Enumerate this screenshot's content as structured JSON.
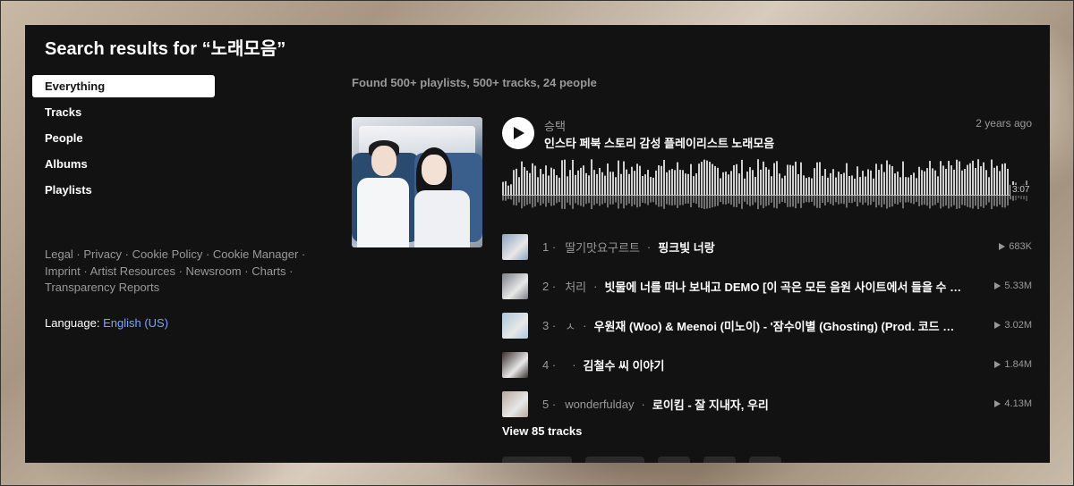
{
  "page": {
    "title": "Search results for “노래모음”"
  },
  "nav": {
    "items": [
      {
        "label": "Everything",
        "active": true
      },
      {
        "label": "Tracks",
        "active": false
      },
      {
        "label": "People",
        "active": false
      },
      {
        "label": "Albums",
        "active": false
      },
      {
        "label": "Playlists",
        "active": false
      }
    ]
  },
  "footer": {
    "links": [
      "Legal",
      "Privacy",
      "Cookie Policy",
      "Cookie Manager",
      "Imprint",
      "Artist Resources",
      "Newsroom",
      "Charts",
      "Transparency Reports"
    ],
    "separator": " · ",
    "language_label": "Language:",
    "language_value": "English (US)"
  },
  "results": {
    "summary": "Found 500+ playlists, 500+ tracks, 24 people"
  },
  "playlist": {
    "owner": "승택",
    "title": "인스타 페북 스토리 감성 플레이리스트 노래모음",
    "posted": "2 years ago",
    "duration": "3:07",
    "progress": 0.97,
    "tracks": [
      {
        "num": "1",
        "artist": "딸기맛요구르트",
        "title": "핑크빛 너랑",
        "plays": "683K",
        "thumb_color": "#8da3c0"
      },
      {
        "num": "2",
        "artist": "처리",
        "title": "빗물에 너를 떠나 보내고 DEMO [이 곡은 모든 음원 사이트에서 들을 수 있습니다]",
        "plays": "5.33M",
        "thumb_color": "#7b8088"
      },
      {
        "num": "3",
        "artist": "ㅅ",
        "title": "우원재 (Woo) & Meenoi (미노이) - '잠수이별 (Ghosting) (Prod. 코드 쿤스트)'",
        "plays": "3.02M",
        "thumb_color": "#a9c7de"
      },
      {
        "num": "4",
        "artist": "",
        "title": "김철수 씨 이야기",
        "plays": "1.84M",
        "thumb_color": "#3a2e2e"
      },
      {
        "num": "5",
        "artist": "wonderfulday",
        "title": "로이킴 - 잘 지내자, 우리",
        "plays": "4.13M",
        "thumb_color": "#b8a89a"
      }
    ],
    "view_tracks": "View 85 tracks"
  },
  "icons": {
    "play": "play-icon",
    "plays_count": "play-count-icon"
  },
  "colors": {
    "panel": "#121212",
    "accent_link": "#7fa2ff",
    "muted": "#999999"
  }
}
